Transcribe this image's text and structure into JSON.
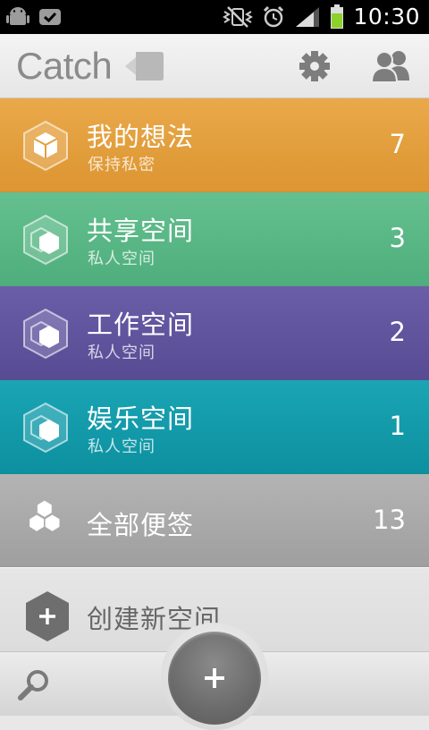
{
  "status_bar": {
    "time": "10:30",
    "icons": [
      "android-icon",
      "check-badge-icon",
      "no-vibrate-icon",
      "alarm-icon",
      "signal-icon",
      "battery-icon"
    ]
  },
  "app_bar": {
    "logo_text": "Catch",
    "actions": [
      "settings-icon",
      "people-icon"
    ]
  },
  "spaces": [
    {
      "title": "我的想法",
      "subtitle": "保持私密",
      "count": "7",
      "color": "#e3a03e",
      "icon": "private-hex-icon"
    },
    {
      "title": "共享空间",
      "subtitle": "私人空间",
      "count": "3",
      "color": "#59b786",
      "icon": "space-hex-icon"
    },
    {
      "title": "工作空间",
      "subtitle": "私人空间",
      "count": "2",
      "color": "#61559e",
      "icon": "space-hex-icon"
    },
    {
      "title": "娱乐空间",
      "subtitle": "私人空间",
      "count": "1",
      "color": "#149baa",
      "icon": "space-hex-icon"
    }
  ],
  "all_notes": {
    "title": "全部便签",
    "count": "13",
    "icon": "hex-cluster-icon"
  },
  "new_space": {
    "title": "创建新空间",
    "icon": "add-hex-icon"
  },
  "bottom_bar": {
    "search_icon": "search-icon",
    "fab_icon": "add-icon"
  }
}
